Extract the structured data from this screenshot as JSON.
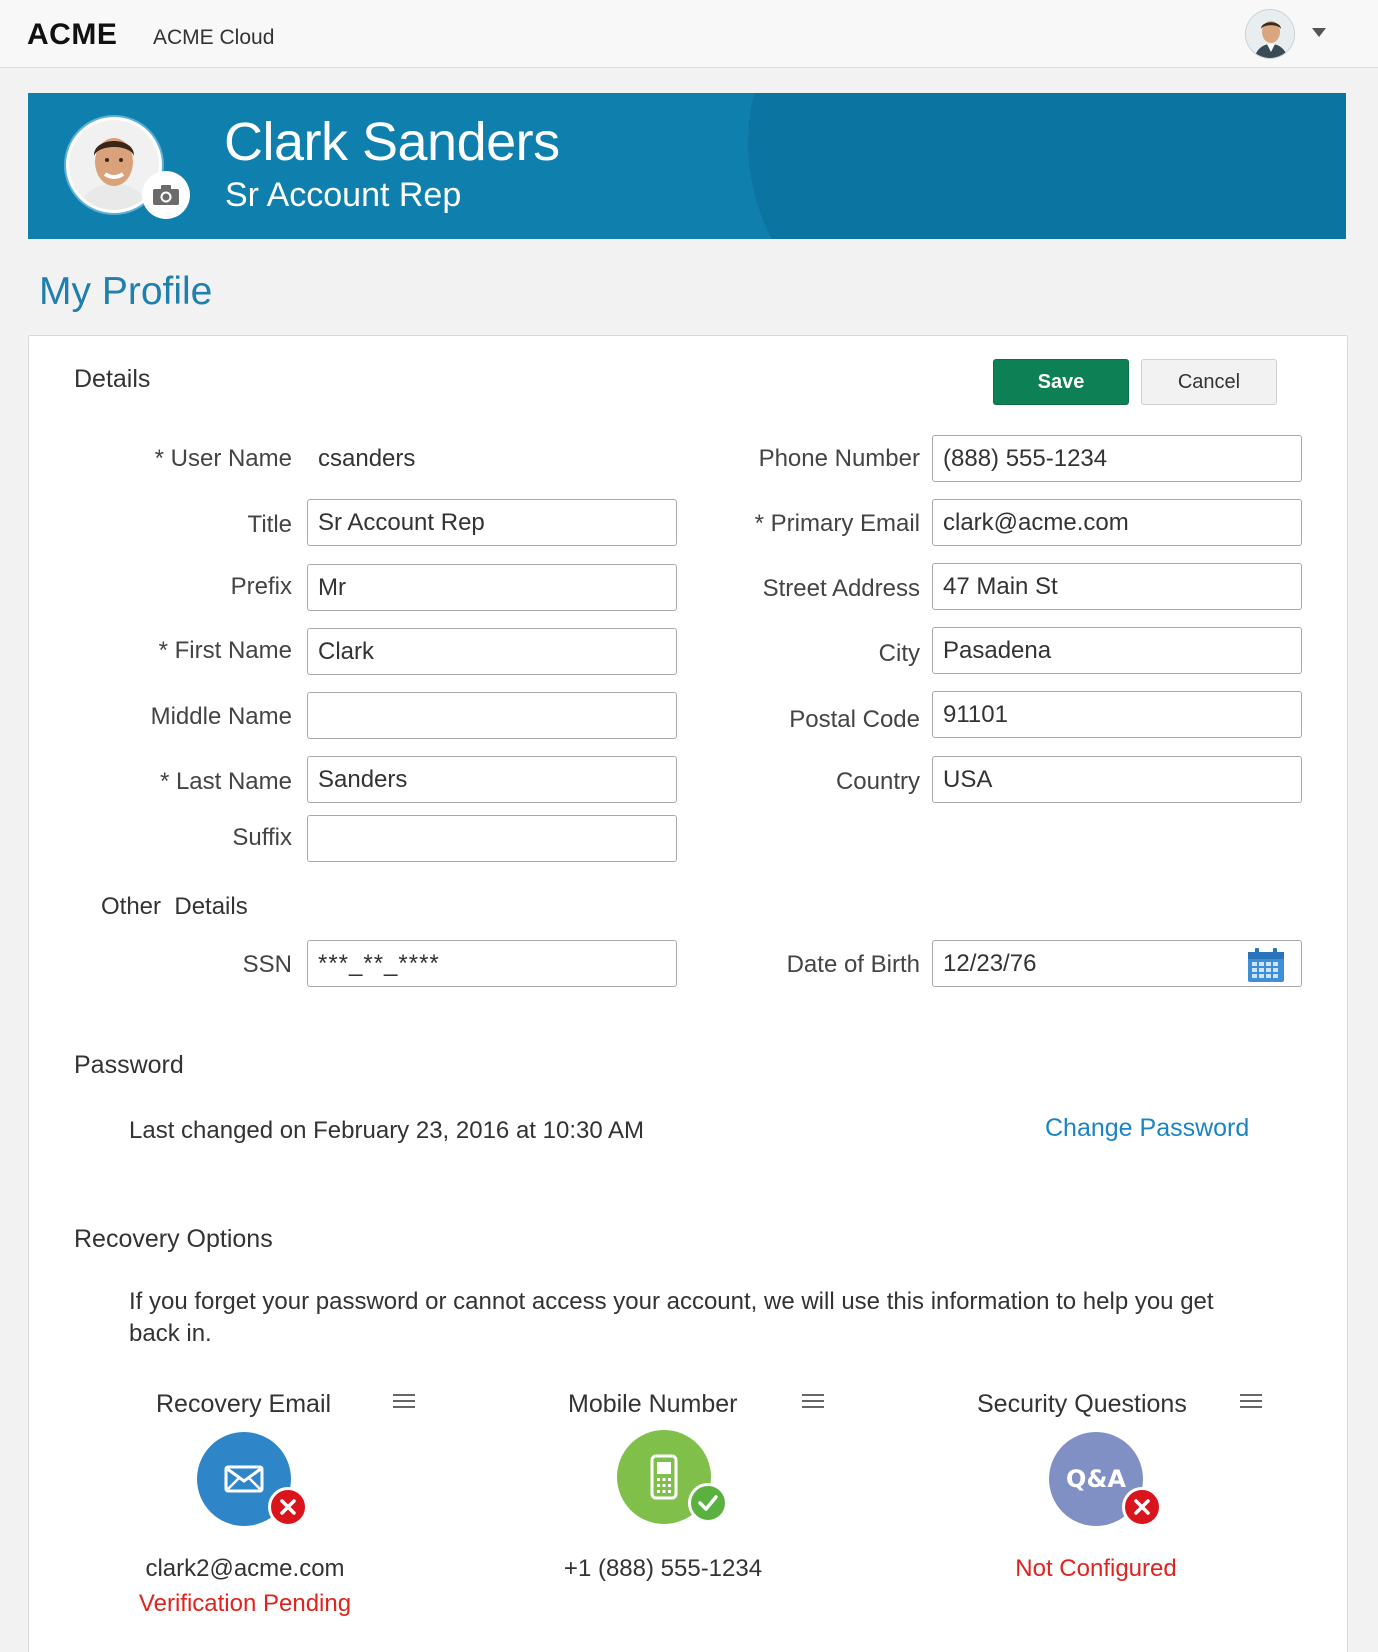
{
  "header": {
    "brand": "ACME",
    "app_name": "ACME Cloud"
  },
  "banner": {
    "name": "Clark Sanders",
    "title": "Sr Account Rep"
  },
  "page_title": "My Profile",
  "details": {
    "heading": "Details",
    "save_label": "Save",
    "cancel_label": "Cancel",
    "username_label": "* User Name",
    "username_value": "csanders",
    "title_label": "Title",
    "title_value": "Sr Account Rep",
    "prefix_label": "Prefix",
    "prefix_value": "Mr",
    "first_name_label": "* First Name",
    "first_name_value": "Clark",
    "middle_name_label": "Middle Name",
    "middle_name_value": "",
    "last_name_label": "* Last Name",
    "last_name_value": "Sanders",
    "suffix_label": "Suffix",
    "suffix_value": "",
    "phone_label": "Phone Number",
    "phone_value": "(888) 555-1234",
    "email_label": "* Primary Email",
    "email_value": "clark@acme.com",
    "street_label": "Street Address",
    "street_value": "47 Main St",
    "city_label": "City",
    "city_value": "Pasadena",
    "postal_label": "Postal Code",
    "postal_value": "91101",
    "country_label": "Country",
    "country_value": "USA"
  },
  "other": {
    "heading": "Other  Details",
    "ssn_label": "SSN",
    "ssn_value": "***_**_****",
    "dob_label": "Date of Birth",
    "dob_value": "12/23/76"
  },
  "password": {
    "heading": "Password",
    "last_changed": "Last changed on February 23, 2016 at 10:30 AM",
    "change_link": "Change Password"
  },
  "recovery": {
    "heading": "Recovery Options",
    "description": "If you forget your password or cannot access your account, we will use this information to help you get back in.",
    "email": {
      "title": "Recovery Email",
      "value": "clark2@acme.com",
      "status": "Verification Pending",
      "color": "#2e86c8",
      "badge_color": "#d9141c"
    },
    "mobile": {
      "title": "Mobile Number",
      "value": "+1 (888) 555-1234",
      "color": "#7fbf4a",
      "badge_color": "#5ab13f"
    },
    "questions": {
      "title": "Security Questions",
      "icon_text": "Q&A",
      "status": "Not Configured",
      "color": "#8190c4",
      "badge_color": "#d9141c"
    }
  }
}
